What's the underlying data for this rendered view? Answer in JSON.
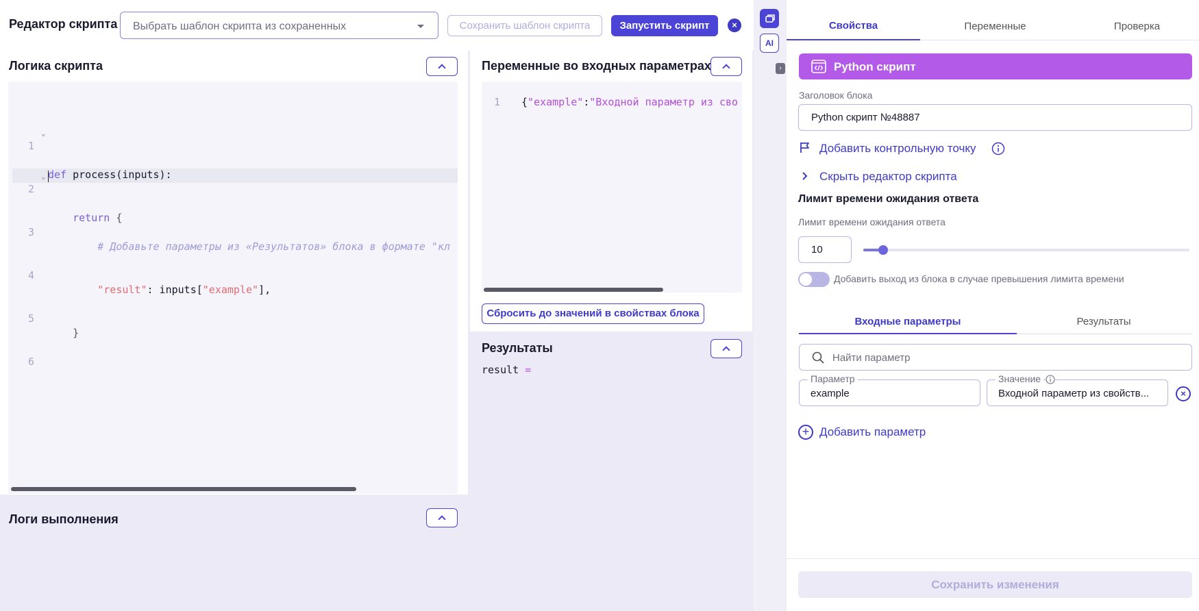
{
  "editor": {
    "title": "Редактор скрипта",
    "template_placeholder": "Выбрать шаблон скрипта из сохраненных",
    "save_template_label": "Сохранить шаблон скрипта",
    "run_label": "Запустить скрипт",
    "close_symbol": "×"
  },
  "logic": {
    "title": "Логика скрипта",
    "lines": [
      {
        "n": "1",
        "fold": "⌄"
      },
      {
        "n": "2",
        "fold": "⌄"
      },
      {
        "n": "3",
        "fold": ""
      },
      {
        "n": "4",
        "fold": ""
      },
      {
        "n": "5",
        "fold": ""
      },
      {
        "n": "6",
        "fold": ""
      }
    ],
    "code": {
      "l1_kw": "def",
      "l1_rest": " process(inputs):",
      "l2_kw": "return",
      "l2_rest": " {",
      "l3": "# Добавьте параметры из «Результатов» блока в формате \"кл",
      "l4_key": "\"result\"",
      "l4_mid": ": inputs[",
      "l4_str": "\"example\"",
      "l4_end": "],",
      "l5": "}"
    }
  },
  "logs": {
    "title": "Логи выполнения"
  },
  "variables": {
    "title": "Переменные во входных параметрах",
    "line_number": "1",
    "code_key": "\"example\"",
    "code_sep": ":",
    "code_value": "\"Входной параметр из сво",
    "code_open": "{",
    "reset_label": "Сбросить до значений в свойствах блока"
  },
  "results": {
    "title": "Результаты",
    "code_name": "result",
    "code_eq": "="
  },
  "sidebar_strip": {
    "ai_label": "AI",
    "expand_symbol": "›"
  },
  "properties": {
    "tabs": [
      "Свойства",
      "Переменные",
      "Проверка"
    ],
    "block_type": "Python скрипт",
    "block_title_label": "Заголовок блока",
    "block_title_value": "Python скрипт №48887",
    "add_checkpoint": "Добавить контрольную точку",
    "hide_editor": "Скрыть редактор скрипта",
    "timeout_section": "Лимит времени ожидания ответа",
    "timeout_label": "Лимит времени ожидания ответа",
    "timeout_value": "10",
    "timeout_slider_fraction": 0.06,
    "toggle_label": "Добавить выход из блока в случае превышения лимита времени",
    "toggle_on": false,
    "param_tabs": [
      "Входные параметры",
      "Результаты"
    ],
    "search_placeholder": "Найти параметр",
    "param_label": "Параметр",
    "param_value": "example",
    "value_label": "Значение",
    "value_value": "Входной параметр из свойств...",
    "add_param": "Добавить параметр",
    "save_changes": "Сохранить изменения"
  },
  "colors": {
    "accent": "#4b44d6",
    "banner": "#b35ae8",
    "muted_bg": "#eceaf6"
  }
}
